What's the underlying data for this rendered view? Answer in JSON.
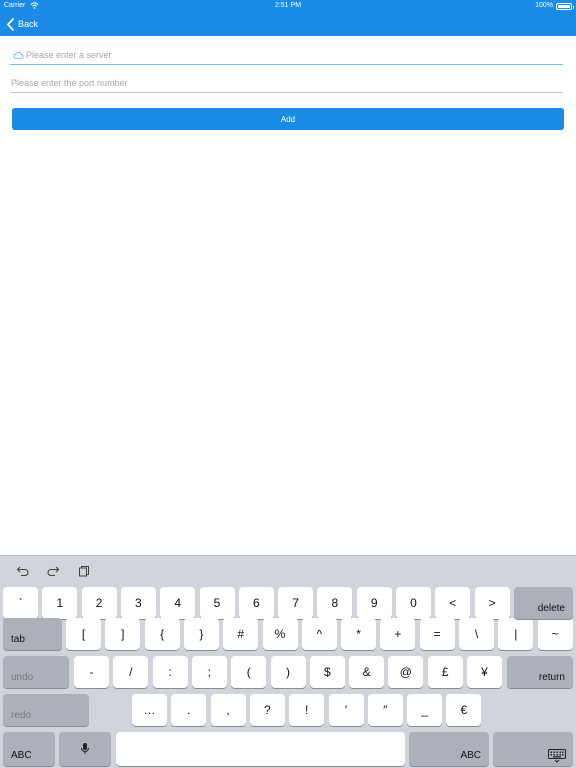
{
  "status_bar": {
    "carrier": "Carrier",
    "time": "2:51 PM",
    "battery": "100%"
  },
  "nav": {
    "back_label": "Back",
    "bar_color": "#1a8ce8"
  },
  "form": {
    "server_placeholder": "Please enter a server",
    "server_value": "",
    "port_placeholder": "Please enter the port number",
    "port_value": "",
    "add_button": "Add",
    "server_icon": "cloud-icon"
  },
  "keyboard": {
    "toolbar_icons": [
      "undo-icon",
      "redo-icon",
      "paste-icon"
    ],
    "row1": [
      "`",
      "1",
      "2",
      "3",
      "4",
      "5",
      "6",
      "7",
      "8",
      "9",
      "0",
      "<",
      ">"
    ],
    "row1_delete": "delete",
    "row2_tab": "tab",
    "row2": [
      "[",
      "]",
      "{",
      "}",
      "#",
      "%",
      "^",
      "*",
      "+",
      "=",
      "\\",
      "|",
      "~"
    ],
    "row3_undo": "undo",
    "row3": [
      "-",
      "/",
      ":",
      ";",
      "(",
      ")",
      "$",
      "&",
      "@",
      "£",
      "¥"
    ],
    "row3_return": "return",
    "row4_redo": "redo",
    "row4": [
      "…",
      ".",
      ",",
      "?",
      "!",
      "′",
      "″",
      "_",
      "€"
    ],
    "row5_abc_left": "ABC",
    "row5_abc_right": "ABC",
    "row5_icons": [
      "microphone-icon",
      "keyboard-dismiss-icon"
    ]
  }
}
